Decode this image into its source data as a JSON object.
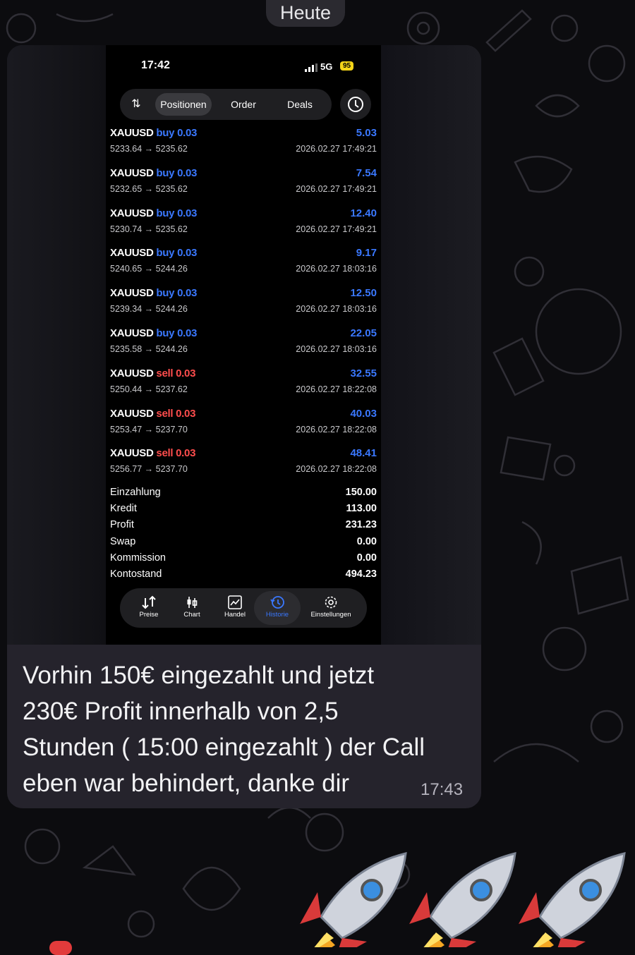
{
  "date_separator": "Heute",
  "phone": {
    "status_time": "17:42",
    "network": "5G",
    "battery": "95",
    "tabs": [
      {
        "label": "Positionen",
        "active": true
      },
      {
        "label": "Order",
        "active": false
      },
      {
        "label": "Deals",
        "active": false
      }
    ],
    "deals": [
      {
        "symbol": "XAUUSD",
        "side": "buy",
        "volume": "0.03",
        "prices": "5233.64 → 5235.62",
        "profit": "5.03",
        "time": "2026.02.27 17:49:21"
      },
      {
        "symbol": "XAUUSD",
        "side": "buy",
        "volume": "0.03",
        "prices": "5232.65 → 5235.62",
        "profit": "7.54",
        "time": "2026.02.27 17:49:21"
      },
      {
        "symbol": "XAUUSD",
        "side": "buy",
        "volume": "0.03",
        "prices": "5230.74 → 5235.62",
        "profit": "12.40",
        "time": "2026.02.27 17:49:21"
      },
      {
        "symbol": "XAUUSD",
        "side": "buy",
        "volume": "0.03",
        "prices": "5240.65 → 5244.26",
        "profit": "9.17",
        "time": "2026.02.27 18:03:16"
      },
      {
        "symbol": "XAUUSD",
        "side": "buy",
        "volume": "0.03",
        "prices": "5239.34 → 5244.26",
        "profit": "12.50",
        "time": "2026.02.27 18:03:16"
      },
      {
        "symbol": "XAUUSD",
        "side": "buy",
        "volume": "0.03",
        "prices": "5235.58 → 5244.26",
        "profit": "22.05",
        "time": "2026.02.27 18:03:16"
      },
      {
        "symbol": "XAUUSD",
        "side": "sell",
        "volume": "0.03",
        "prices": "5250.44 → 5237.62",
        "profit": "32.55",
        "time": "2026.02.27 18:22:08"
      },
      {
        "symbol": "XAUUSD",
        "side": "sell",
        "volume": "0.03",
        "prices": "5253.47 → 5237.70",
        "profit": "40.03",
        "time": "2026.02.27 18:22:08"
      },
      {
        "symbol": "XAUUSD",
        "side": "sell",
        "volume": "0.03",
        "prices": "5256.77 → 5237.70",
        "profit": "48.41",
        "time": "2026.02.27 18:22:08"
      }
    ],
    "summary": [
      {
        "label": "Einzahlung",
        "value": "150.00"
      },
      {
        "label": "Kredit",
        "value": "113.00"
      },
      {
        "label": "Profit",
        "value": "231.23"
      },
      {
        "label": "Swap",
        "value": "0.00"
      },
      {
        "label": "Kommission",
        "value": "0.00"
      },
      {
        "label": "Kontostand",
        "value": "494.23"
      }
    ],
    "nav": [
      {
        "label": "Preise",
        "icon": "arrows-icon"
      },
      {
        "label": "Chart",
        "icon": "candles-icon"
      },
      {
        "label": "Handel",
        "icon": "trend-icon"
      },
      {
        "label": "Historie",
        "icon": "history-icon",
        "active": true
      },
      {
        "label": "Einstellungen",
        "icon": "gear-icon"
      }
    ]
  },
  "message": {
    "lines": [
      "Vorhin 150€ eingezahlt und jetzt",
      "230€ Profit innerhalb von 2,5",
      "Stunden ( 15:00 eingezahlt ) der Call",
      "eben war behindert, danke dir"
    ],
    "time": "17:43"
  },
  "reaction": {
    "emoji": "rocket-icon",
    "count": 3
  },
  "colors": {
    "buy": "#3a78ff",
    "sell": "#ff4d4d",
    "profit": "#3a78ff",
    "bubble": "#25232c",
    "active_nav": "#3a78ff"
  }
}
